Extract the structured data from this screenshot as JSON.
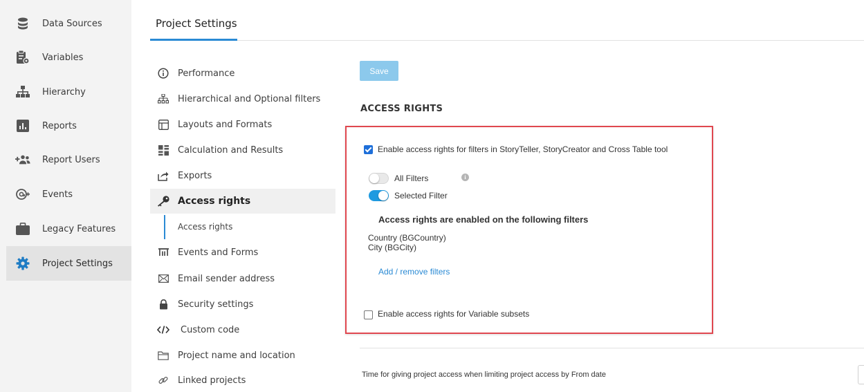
{
  "sidebar": {
    "items": [
      {
        "label": "Data Sources",
        "icon": "database-icon"
      },
      {
        "label": "Variables",
        "icon": "variables-icon"
      },
      {
        "label": "Hierarchy",
        "icon": "hierarchy-icon"
      },
      {
        "label": "Reports",
        "icon": "reports-icon"
      },
      {
        "label": "Report Users",
        "icon": "add-users-icon"
      },
      {
        "label": "Events",
        "icon": "events-icon"
      },
      {
        "label": "Legacy Features",
        "icon": "briefcase-icon"
      },
      {
        "label": "Project Settings",
        "icon": "gear-icon"
      }
    ],
    "active": "Project Settings"
  },
  "header": {
    "tab": "Project Settings"
  },
  "settings_nav": {
    "items": [
      {
        "label": "Performance",
        "icon": "info-circle-icon"
      },
      {
        "label": "Hierarchical and Optional filters",
        "icon": "tree-icon"
      },
      {
        "label": "Layouts and Formats",
        "icon": "layout-icon"
      },
      {
        "label": "Calculation and Results",
        "icon": "calculator-icon"
      },
      {
        "label": "Exports",
        "icon": "export-icon"
      },
      {
        "label": "Access rights",
        "icon": "key-icon"
      },
      {
        "label": "Events and Forms",
        "icon": "forms-icon"
      },
      {
        "label": "Email sender address",
        "icon": "envelope-icon"
      },
      {
        "label": "Security settings",
        "icon": "lock-icon"
      },
      {
        "label": "Custom code",
        "icon": "code-icon"
      },
      {
        "label": "Project name and location",
        "icon": "folder-icon"
      },
      {
        "label": "Linked projects",
        "icon": "link-icon"
      }
    ],
    "active": "Access rights",
    "sub_item": "Access rights"
  },
  "main": {
    "save_label": "Save",
    "section_title": "ACCESS RIGHTS",
    "enable_filters_label": "Enable access rights for filters in StoryTeller, StoryCreator and Cross Table tool",
    "enable_filters_checked": true,
    "toggle_all_label": "All Filters",
    "toggle_all_on": false,
    "toggle_selected_label": "Selected Filter",
    "toggle_selected_on": true,
    "enabled_heading": "Access rights are enabled on the following filters",
    "filters": [
      "Country (BGCountry)",
      "City (BGCity)"
    ],
    "add_remove_link": "Add / remove filters",
    "enable_variable_label": "Enable access rights for Variable subsets",
    "enable_variable_checked": false,
    "bottom_text": "Time for giving project access when limiting project access by From date"
  },
  "colors": {
    "accent": "#2a8ad4",
    "toggle_on": "#1e9ae0",
    "highlight_border": "#e0474f",
    "save_button": "#8cc9ec",
    "checkbox": "#1e6fd9"
  }
}
